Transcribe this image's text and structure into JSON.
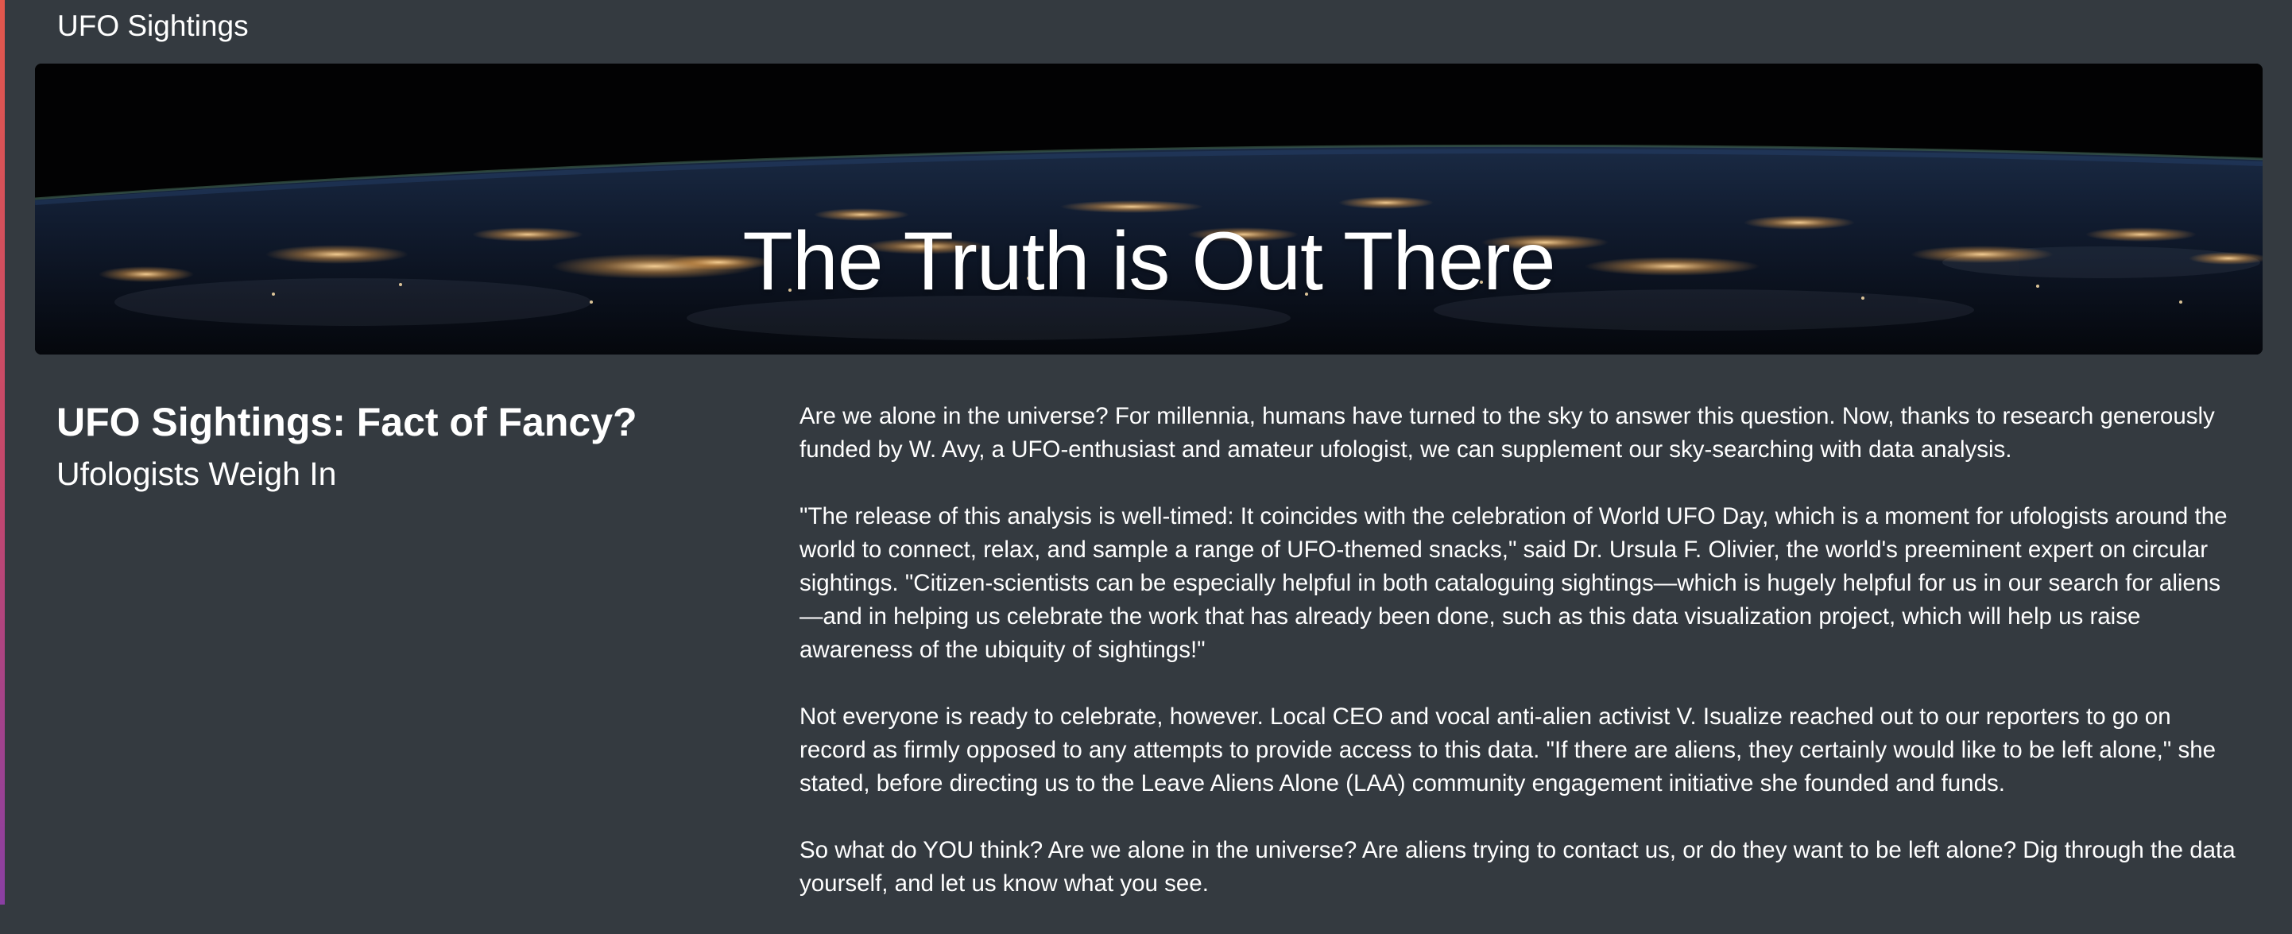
{
  "navbar": {
    "brand": "UFO Sightings"
  },
  "hero": {
    "title": "The Truth is Out There"
  },
  "article": {
    "heading_main": "UFO Sightings: Fact of Fancy?",
    "heading_sub": "Ufologists Weigh In",
    "paragraphs": [
      "Are we alone in the universe? For millennia, humans have turned to the sky to answer this question. Now, thanks to research generously funded by W. Avy, a UFO-enthusiast and amateur ufologist, we can supplement our sky-searching with data analysis.",
      "\"The release of this analysis is well-timed: It coincides with the celebration of World UFO Day, which is a moment for ufologists around the world to connect, relax, and sample a range of UFO-themed snacks,\" said Dr. Ursula F. Olivier, the world's preeminent expert on circular sightings. \"Citizen-scientists can be especially helpful in both cataloguing sightings—which is hugely helpful for us in our search for aliens—and in helping us celebrate the work that has already been done, such as this data visualization project, which will help us raise awareness of the ubiquity of sightings!\"",
      "Not everyone is ready to celebrate, however. Local CEO and vocal anti-alien activist V. Isualize reached out to our reporters to go on record as firmly opposed to any attempts to provide access to this data. \"If there are aliens, they certainly would like to be left alone,\" she stated, before directing us to the Leave Aliens Alone (LAA) community engagement initiative she founded and funds.",
      "So what do YOU think? Are we alone in the universe? Are aliens trying to contact us, or do they want to be left alone? Dig through the data yourself, and let us know what you see."
    ]
  },
  "colors": {
    "background": "#343a40",
    "text": "#ffffff",
    "accent_top": "#e2574c",
    "accent_bottom": "#8a3fa3"
  }
}
